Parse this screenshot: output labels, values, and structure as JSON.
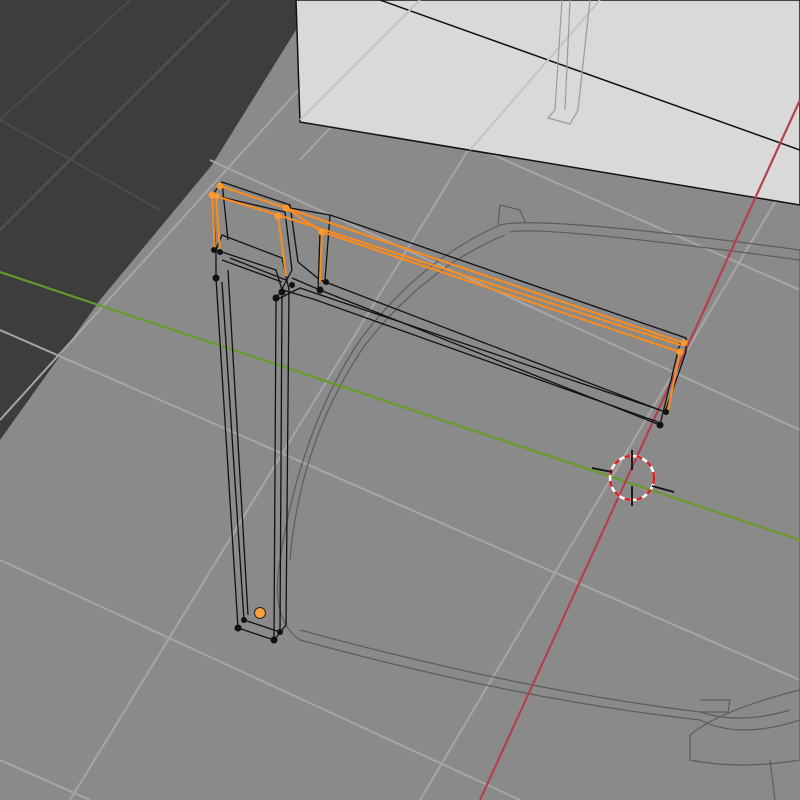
{
  "viewport": {
    "mode": "edit-mode",
    "view": "perspective",
    "colors": {
      "floor": "#8a8a8a",
      "grid_line": "#a3a3a3",
      "dark_plane": "#3d3d3d",
      "box_face": "#d9d9d9",
      "x_axis": "#b3404f",
      "y_axis": "#6a9a2a",
      "wire": "#111111",
      "ghost_wire": "#5c5c5c",
      "selected_edge": "#ff8c1a",
      "selected_vertex": "#ff9a2e",
      "active_vertex": "#ffa040",
      "cursor_red": "#e02020",
      "cursor_white": "#ffffff"
    },
    "icons": [
      "3d-cursor-icon"
    ]
  }
}
